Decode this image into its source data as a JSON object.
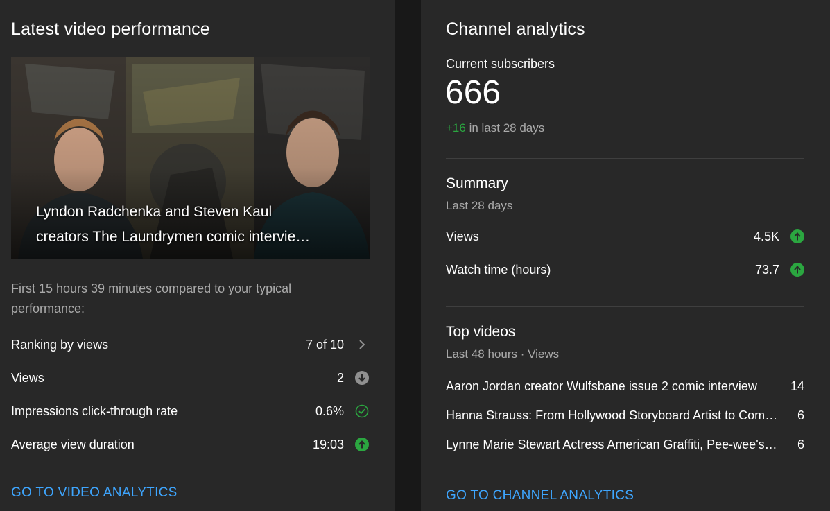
{
  "latest_video": {
    "card_title": "Latest video performance",
    "thumbnail": {
      "title_line1": "Lyndon Radchenka and Steven Kaul",
      "title_line2": "creators The Laundrymen comic intervie…"
    },
    "compare_note": "First 15 hours 39 minutes compared to your typical performance:",
    "metrics": [
      {
        "label": "Ranking by views",
        "value": "7 of 10",
        "icon": "chevron-right-icon"
      },
      {
        "label": "Views",
        "value": "2",
        "icon": "arrow-down-circle-icon"
      },
      {
        "label": "Impressions click-through rate",
        "value": "0.6%",
        "icon": "check-circle-icon"
      },
      {
        "label": "Average view duration",
        "value": "19:03",
        "icon": "arrow-up-circle-icon"
      }
    ],
    "link_label": "GO TO VIDEO ANALYTICS"
  },
  "channel": {
    "card_title": "Channel analytics",
    "subscribers_label": "Current subscribers",
    "subscribers_count": "666",
    "subscribers_delta": "+16",
    "subscribers_delta_suffix": "in last 28 days",
    "summary": {
      "title": "Summary",
      "period": "Last 28 days",
      "rows": [
        {
          "label": "Views",
          "value": "4.5K",
          "icon": "arrow-up-circle-icon"
        },
        {
          "label": "Watch time (hours)",
          "value": "73.7",
          "icon": "arrow-up-circle-icon"
        }
      ]
    },
    "top_videos": {
      "title": "Top videos",
      "period": "Last 48 hours · Views",
      "rows": [
        {
          "title": "Aaron Jordan creator Wulfsbane issue 2 comic interview",
          "value": "14"
        },
        {
          "title": "Hanna Strauss: From Hollywood Storyboard Artist to Comics",
          "value": "6"
        },
        {
          "title": "Lynne Marie Stewart Actress American Graffiti, Pee-wee's Playhouse",
          "value": "6"
        }
      ]
    },
    "link_label": "GO TO CHANNEL ANALYTICS"
  },
  "colors": {
    "background": "#181818",
    "card": "#282828",
    "link": "#3ea6ff",
    "positive": "#2ba640",
    "muted": "#aaaaaa"
  }
}
